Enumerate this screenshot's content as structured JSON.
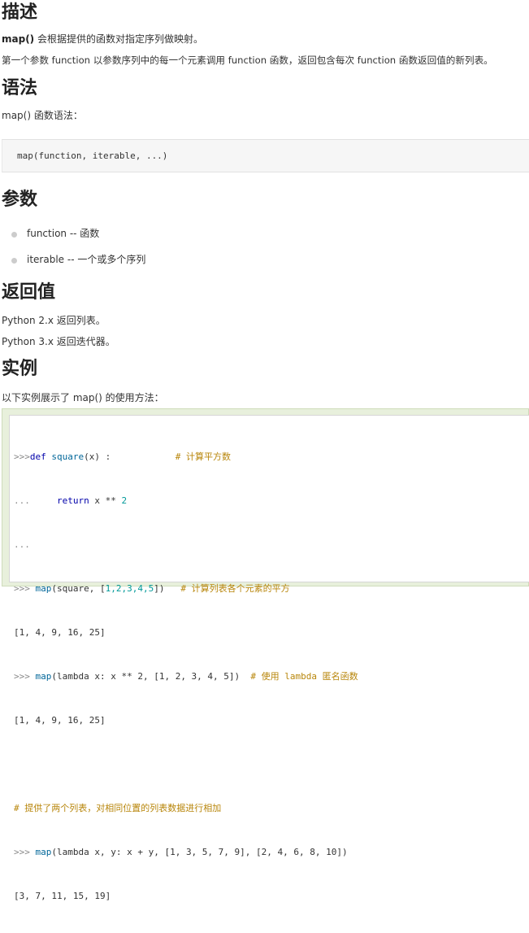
{
  "sections": {
    "desc_heading": "描述",
    "desc_func_name": "map()",
    "desc_line1_rest": " 会根据提供的函数对指定序列做映射。",
    "desc_line2": "第一个参数 function 以参数序列中的每一个元素调用 function 函数，返回包含每次 function 函数返回值的新列表。",
    "syntax_heading": "语法",
    "syntax_intro": "map() 函数语法：",
    "syntax_code": "map(function, iterable, ...)",
    "params_heading": "参数",
    "params": [
      "function -- 函数",
      "iterable -- 一个或多个序列"
    ],
    "return_heading": "返回值",
    "return_lines": [
      "Python 2.x 返回列表。",
      "Python 3.x 返回迭代器。"
    ],
    "example_heading": "实例",
    "example_intro": "以下实例展示了 map() 的使用方法："
  },
  "example_code": {
    "l1_prompt": ">>>",
    "l1_kw": "def",
    "l1_sp": " ",
    "l1_fn": "square",
    "l1_rest": "(x) :            ",
    "l1_cmt": "# 计算平方数",
    "l2_prompt": "...",
    "l2_indent": "     ",
    "l2_kw": "return",
    "l2_rest": " x ** ",
    "l2_num": "2",
    "l3_prompt": "...",
    "l4_prompt": ">>> ",
    "l4_fn": "map",
    "l4_rest": "(square, [",
    "l4_nums": "1,2,3,4,5",
    "l4_rest2": "])   ",
    "l4_cmt": "# 计算列表各个元素的平方",
    "l5_out": "[1, 4, 9, 16, 25]",
    "l6_prompt": ">>> ",
    "l6_fn": "map",
    "l6_rest": "(lambda x: x ** 2, [1, 2, 3, 4, 5])  ",
    "l6_cmt": "# 使用 lambda 匿名函数",
    "l7_out": "[1, 4, 9, 16, 25]",
    "l9_cmt": "# 提供了两个列表，对相同位置的列表数据进行相加",
    "l10_prompt": ">>> ",
    "l10_fn": "map",
    "l10_rest": "(lambda x, y: x + y, [1, 3, 5, 7, 9], [2, 4, 6, 8, 10])",
    "l11_out": "[3, 7, 11, 15, 19]"
  }
}
